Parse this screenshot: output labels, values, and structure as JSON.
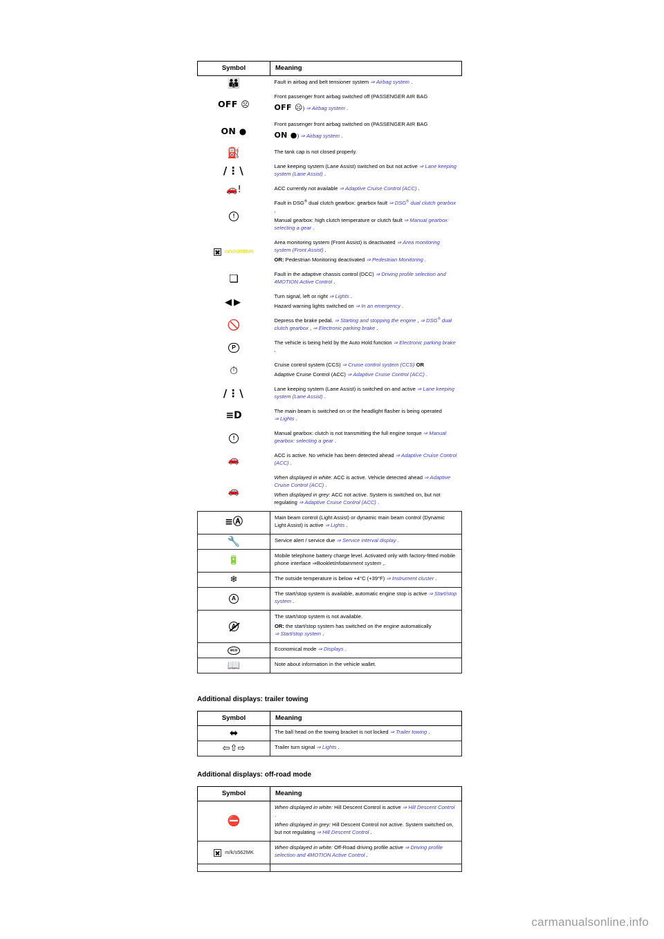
{
  "page": {
    "watermark": "carmanualsonline.info"
  },
  "table_main": {
    "headers": {
      "symbol": "Symbol",
      "meaning": "Meaning"
    },
    "rows": [
      {
        "symbol_kind": "airbag-fault",
        "symbol_text": "",
        "lines": [
          {
            "text": "Fault in airbag and belt tensioner system ",
            "ref": "Airbag system",
            "tail": " ."
          }
        ]
      },
      {
        "symbol_kind": "airbag-off",
        "symbol_text": "OFF",
        "lines": [
          {
            "text": "Front passenger front airbag switched off (PASSENGER AIR BAG",
            "ref": "",
            "tail": ""
          },
          {
            "inline_symbol": "OFF",
            "text": ") ",
            "ref": "Airbag system",
            "tail": " ."
          }
        ]
      },
      {
        "symbol_kind": "airbag-on",
        "symbol_text": "ON",
        "lines": [
          {
            "text": "Front passenger front airbag switched on (PASSENGER AIR BAG",
            "ref": "",
            "tail": ""
          },
          {
            "inline_symbol": "ON",
            "text": ") ",
            "ref": "Airbag system",
            "tail": " ."
          }
        ]
      },
      {
        "symbol_kind": "fuel-cap",
        "symbol_text": "",
        "lines": [
          {
            "text": "The tank cap is not closed properly.",
            "ref": "",
            "tail": ""
          }
        ]
      },
      {
        "symbol_kind": "lane-assist",
        "symbol_text": "",
        "lines": [
          {
            "text": "Lane keeping system (Lane Assist) switched on but not active ",
            "ref": "Lane keeping system (Lane Assist)",
            "tail": " ."
          }
        ]
      },
      {
        "symbol_kind": "acc-unavailable",
        "symbol_text": "",
        "lines": [
          {
            "text": "ACC currently not available ",
            "ref": "Adaptive Cruise Control (ACC)",
            "tail": " ."
          }
        ]
      },
      {
        "symbol_kind": "gearbox-fault",
        "symbol_text": "",
        "lines": [
          {
            "text": "Fault in DSG<sup>®</sup> dual clutch gearbox: gearbox fault ",
            "ref": "DSG<sup>®</sup> dual clutch gearbox",
            "tail": " ."
          },
          {
            "text": "Manual gearbox: high clutch temperature or clutch fault ",
            "ref": "Manual gearbox: selecting a gear",
            "tail": " ."
          }
        ]
      },
      {
        "symbol_kind": "broken-image-yellow",
        "symbol_text": "m/k/n998MK",
        "lines": [
          {
            "text": "Area monitoring system (Front Assist) is deactivated ",
            "ref": "Area monitoring system (Front Assist)",
            "tail": " ."
          },
          {
            "bold_prefix": "OR:",
            "text": " Pedestrian Monitoring deactivated ",
            "ref": "Pedestrian Monitoring",
            "tail": " ."
          }
        ]
      },
      {
        "symbol_kind": "dcc-shock",
        "symbol_text": "",
        "lines": [
          {
            "text": "Fault in the adaptive chassis control (DCC) ",
            "ref": "Driving profile selection and 4MOTION Active Control",
            "tail": " ."
          }
        ]
      },
      {
        "symbol_kind": "turn-signals",
        "symbol_text": "",
        "lines": [
          {
            "text": "Turn signal, left or right ",
            "ref": "Lights",
            "tail": " ."
          },
          {
            "text": "Hazard warning lights switched on ",
            "ref": "In an emergency",
            "tail": " ."
          }
        ]
      },
      {
        "symbol_kind": "brake-pedal",
        "symbol_text": "",
        "lines": [
          {
            "text": "Depress the brake pedal. ",
            "ref": "Starting and stopping the engine",
            "tail": " , ",
            "ref2": "DSG<sup>®</sup> dual clutch gearbox",
            "tail2": " , ",
            "ref3": "Electronic parking brake",
            "tail3": " ."
          }
        ]
      },
      {
        "symbol_kind": "auto-hold",
        "symbol_text": "",
        "lines": [
          {
            "text": "The vehicle is being held by the Auto Hold function ",
            "ref": "Electronic parking brake",
            "tail": " ."
          }
        ]
      },
      {
        "symbol_kind": "cruise-control",
        "symbol_text": "",
        "lines": [
          {
            "text": "Cruise control system (CCS) ",
            "ref": "Cruise control system (CCS)",
            "tail": " ",
            "bold_suffix": "OR"
          },
          {
            "text": "Adaptive Cruise Control (ACC) ",
            "ref": "Adaptive Cruise Control (ACC)",
            "tail": " ."
          }
        ]
      },
      {
        "symbol_kind": "lane-assist",
        "symbol_text": "",
        "lines": [
          {
            "text": "Lane keeping system (Lane Assist) is switched on and active ",
            "ref": "Lane keeping system (Lane Assist)",
            "tail": " ."
          }
        ]
      },
      {
        "symbol_kind": "main-beam",
        "symbol_text": "",
        "lines": [
          {
            "text": "The main beam is switched on or the headlight flasher is being operated ",
            "ref": "Lights",
            "tail": " ."
          }
        ]
      },
      {
        "symbol_kind": "clutch-torque",
        "symbol_text": "",
        "lines": [
          {
            "text": "Manual gearbox: clutch is not transmitting the full engine torque ",
            "ref": "Manual gearbox: selecting a gear",
            "tail": " ."
          }
        ]
      },
      {
        "symbol_kind": "acc-active-nocar",
        "symbol_text": "",
        "lines": [
          {
            "text": "ACC is active. No vehicle has been detected ahead ",
            "ref": "Adaptive Cruise Control (ACC)",
            "tail": " ."
          }
        ]
      },
      {
        "symbol_kind": "acc-detected",
        "symbol_text": "",
        "lines": [
          {
            "italic_prefix": "When displayed in white:",
            "text": " ACC is active. Vehicle detected ahead ",
            "ref": "Adaptive Cruise Control (ACC)",
            "tail": " ."
          },
          {
            "italic_prefix": "When displayed in grey:",
            "text": " ACC not active. System is switched on, but not regulating ",
            "ref": "Adaptive Cruise Control (ACC)",
            "tail": " ."
          }
        ]
      },
      {
        "symbol_kind": "light-assist",
        "symbol_text": "",
        "lines": [
          {
            "text": "Main beam control (Light Assist) or dynamic main beam control (Dynamic Light Assist) is active ",
            "ref": "Lights",
            "tail": " ."
          }
        ]
      },
      {
        "symbol_kind": "wrench",
        "symbol_text": "",
        "lines": [
          {
            "text": "Service alert / service due ",
            "ref": "Service interval display",
            "tail": " ."
          }
        ]
      },
      {
        "symbol_kind": "battery",
        "symbol_text": "",
        "lines": [
          {
            "text": "Mobile telephone battery charge level. Activated only with factory-fitted mobile phone interface ⇒Booklet",
            "ref_it_plain": "Infotainment system",
            "tail": " ,."
          }
        ]
      },
      {
        "symbol_kind": "snowflake",
        "symbol_text": "",
        "lines": [
          {
            "text": "The outside temperature is below +4°C (+39°F) ",
            "ref": "Instrument cluster",
            "tail": " ."
          }
        ]
      },
      {
        "symbol_kind": "start-stop-a",
        "symbol_text": "",
        "lines": [
          {
            "text": "The start/stop system is available, automatic engine stop is active ",
            "ref": "Start/stop system",
            "tail": "  ."
          }
        ]
      },
      {
        "symbol_kind": "start-stop-a-slash",
        "symbol_text": "",
        "lines": [
          {
            "text": "The start/stop system is not available.",
            "ref": "",
            "tail": ""
          },
          {
            "bold_prefix": "OR:",
            "text": " the start/stop system has switched on the engine automatically ",
            "ref": "Start/stop system",
            "tail": "  ."
          }
        ]
      },
      {
        "symbol_kind": "eco",
        "symbol_text": "",
        "lines": [
          {
            "text": "Economical mode ",
            "ref": "Displays",
            "tail": " ."
          }
        ]
      },
      {
        "symbol_kind": "booklet",
        "symbol_text": "",
        "lines": [
          {
            "text": "Note about information in the vehicle wallet.",
            "ref": "",
            "tail": ""
          }
        ]
      }
    ]
  },
  "section_trailer": {
    "title": "Additional displays: trailer towing",
    "headers": {
      "symbol": "Symbol",
      "meaning": "Meaning"
    },
    "rows": [
      {
        "symbol_kind": "towbar",
        "lines": [
          {
            "text": "The ball head on the towing bracket is not locked ",
            "ref": "Trailer towing",
            "tail": " ."
          }
        ]
      },
      {
        "symbol_kind": "trailer-turn",
        "lines": [
          {
            "text": "Trailer turn signal ",
            "ref": "Lights",
            "tail": " ."
          }
        ]
      }
    ]
  },
  "section_offroad": {
    "title": "Additional displays: off-road mode",
    "headers": {
      "symbol": "Symbol",
      "meaning": "Meaning"
    },
    "rows": [
      {
        "symbol_kind": "hill-descent",
        "lines": [
          {
            "italic_prefix": "When displayed in white:",
            "text": " Hill Descent Control is active ",
            "ref": "Hill Descent Control",
            "tail": " ."
          },
          {
            "italic_prefix": "When displayed in grey:",
            "text": " Hill Descent Control not active. System switched on, but not regulating ",
            "ref": "Hill Descent Control",
            "tail": " ."
          }
        ]
      },
      {
        "symbol_kind": "broken-image-black",
        "symbol_text": "m/k/s562MK",
        "lines": [
          {
            "italic_prefix": "When displayed in white:",
            "text": " Off-Road driving profile active ",
            "ref": "Driving profile selection and 4MOTION Active Control",
            "tail": " ."
          }
        ]
      },
      {
        "symbol_kind": "empty",
        "lines": [
          {
            "text": "",
            "ref": "",
            "tail": ""
          }
        ]
      }
    ]
  }
}
